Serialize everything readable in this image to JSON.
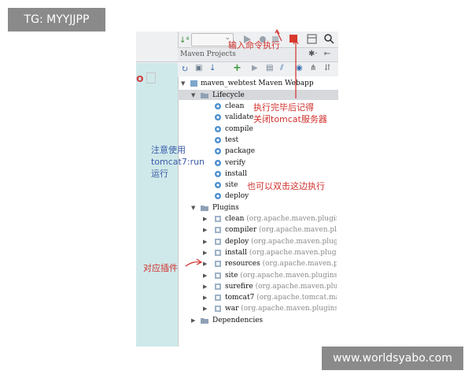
{
  "watermarks": {
    "top_left": "TG: MYYJJPP",
    "bottom_right": "www.worldsyabo.com"
  },
  "panel": {
    "title": "Maven Projects"
  },
  "tree": {
    "root": "maven_webtest Maven Webapp",
    "lifecycle": {
      "label": "Lifecycle",
      "items": [
        "clean",
        "validate",
        "compile",
        "test",
        "package",
        "verify",
        "install",
        "site",
        "deploy"
      ]
    },
    "plugins": {
      "label": "Plugins",
      "items": [
        {
          "name": "clean",
          "extra": "(org.apache.maven.plugins:maven"
        },
        {
          "name": "compiler",
          "extra": "(org.apache.maven.plugins:ma"
        },
        {
          "name": "deploy",
          "extra": "(org.apache.maven.plugins:mav"
        },
        {
          "name": "install",
          "extra": "(org.apache.maven.plugins:mav"
        },
        {
          "name": "resources",
          "extra": "(org.apache.maven.plugins:m"
        },
        {
          "name": "site",
          "extra": "(org.apache.maven.plugins:maven-"
        },
        {
          "name": "surefire",
          "extra": "(org.apache.maven.plugins:ma"
        },
        {
          "name": "tomcat7",
          "extra": "(org.apache.tomcat.maven:tom"
        },
        {
          "name": "war",
          "extra": "(org.apache.maven.plugins:maven-"
        }
      ]
    },
    "dependencies": "Dependencies"
  },
  "annotations": {
    "input_command": "输入命令执行",
    "close_tomcat_1": "执行完毕后记得",
    "close_tomcat_2": "关闭tomcat服务器",
    "note_1": "注意使用",
    "note_2": "tomcat7:run",
    "note_3": "运行",
    "double_click": "也可以双击这边执行",
    "plugins_note": "对应插件"
  },
  "colors": {
    "annotation_red": "#d0302c",
    "annotation_blue": "#3b5aa8",
    "stop_red": "#d83a2d",
    "selected_row": "#d6d8dc",
    "editor_teal": "#cfe9ea"
  },
  "icons": [
    "run-icon",
    "stop-icon",
    "settings-icon",
    "refresh-icon",
    "add-icon",
    "execute-icon",
    "gear-icon",
    "folder-icon",
    "plugin-icon"
  ]
}
